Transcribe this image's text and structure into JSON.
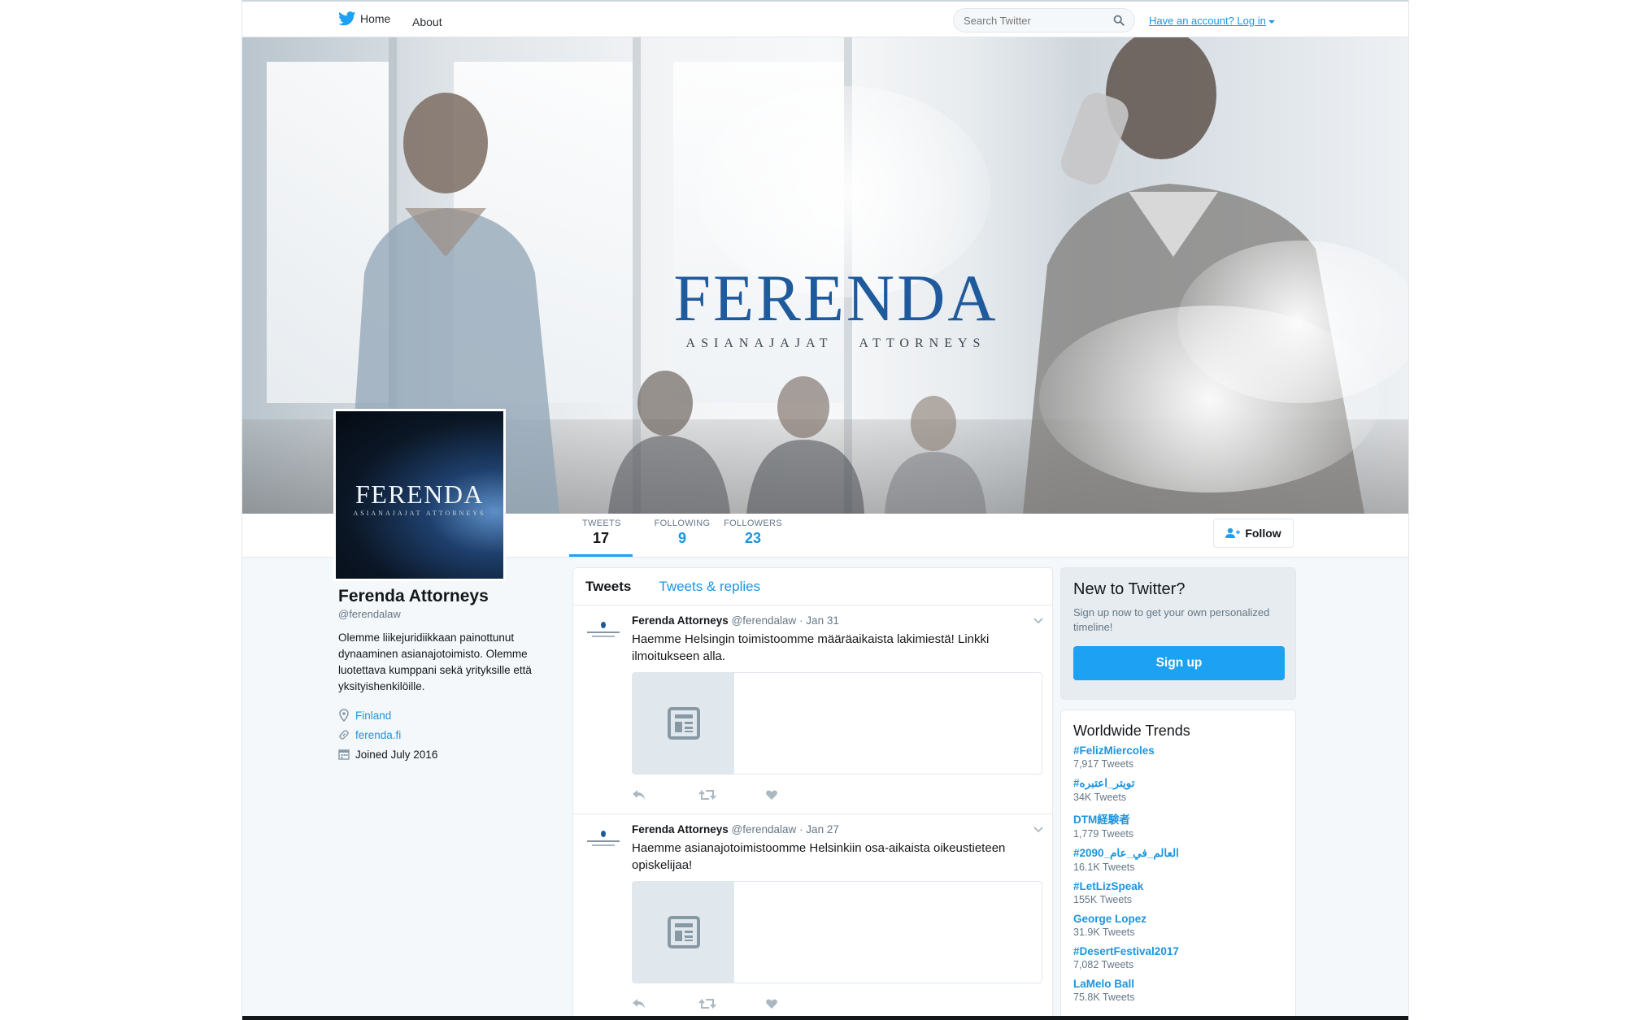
{
  "nav": {
    "home": "Home",
    "about": "About",
    "search_placeholder": "Search Twitter",
    "login_prefix": "Have an account?",
    "login": "Log in"
  },
  "banner": {
    "brand": "FERENDA",
    "tagline": "ASIANAJAJAT   ATTORNEYS"
  },
  "avatar": {
    "brand": "FERENDA",
    "tagline": "ASIANAJAJAT ATTORNEYS"
  },
  "stats": [
    {
      "label": "TWEETS",
      "value": "17"
    },
    {
      "label": "FOLLOWING",
      "value": "9"
    },
    {
      "label": "FOLLOWERS",
      "value": "23"
    }
  ],
  "follow_label": "Follow",
  "profile": {
    "name": "Ferenda Attorneys",
    "handle": "@ferendalaw",
    "bio": "Olemme liikejuridiikkaan painottunut dynaaminen asianajotoimisto. Olemme luotettava kumppani sekä yrityksille että yksityishenkilöille.",
    "location": "Finland",
    "website": "ferenda.fi",
    "joined": "Joined July 2016"
  },
  "timeline": {
    "tab_tweets": "Tweets",
    "tab_replies": "Tweets & replies",
    "tweets": [
      {
        "name": "Ferenda Attorneys",
        "handle": "@ferendalaw",
        "date": "· Jan 31",
        "text": "Haemme Helsingin toimistoomme määräaikaista lakimiestä! Linkki ilmoitukseen alla."
      },
      {
        "name": "Ferenda Attorneys",
        "handle": "@ferendalaw",
        "date": "· Jan 27",
        "text": "Haemme asianajotoimistoomme Helsinkiin osa-aikaista oikeustieteen opiskelijaa!"
      }
    ]
  },
  "signup": {
    "title": "New to Twitter?",
    "text": "Sign up now to get your own personalized timeline!",
    "button": "Sign up"
  },
  "trends": {
    "title": "Worldwide Trends",
    "items": [
      {
        "name": "#FelizMiercoles",
        "count": "7,917 Tweets"
      },
      {
        "name": "#تويتر_اعتبره",
        "count": "34K Tweets"
      },
      {
        "name": "DTM経験者",
        "count": "1,779 Tweets"
      },
      {
        "name": "#العالم_في_عام_2090",
        "count": "16.1K Tweets"
      },
      {
        "name": "#LetLizSpeak",
        "count": "155K Tweets"
      },
      {
        "name": "George Lopez",
        "count": "31.9K Tweets"
      },
      {
        "name": "#DesertFestival2017",
        "count": "7,082 Tweets"
      },
      {
        "name": "LaMelo Ball",
        "count": "75.8K Tweets"
      }
    ]
  },
  "colors": {
    "accent": "#1da1f2",
    "link": "#1b95e0",
    "brand_blue": "#1e5a9c"
  }
}
